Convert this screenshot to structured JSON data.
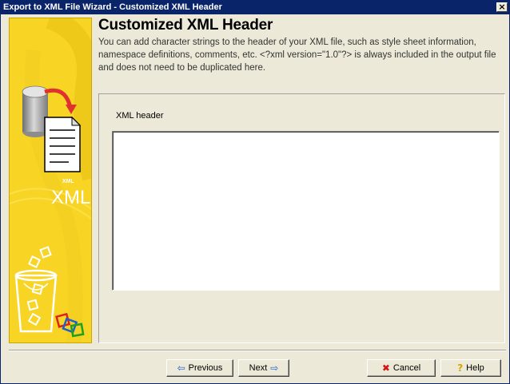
{
  "window": {
    "title": "Export to XML File Wizard - Customized XML Header",
    "close_glyph": "×"
  },
  "side_panel": {
    "image": "xml-export-illustration",
    "xml_small": "XML",
    "xml_large": "XML",
    "colors": {
      "background": "#f8d424",
      "arrow": "#e03030"
    }
  },
  "header": {
    "title": "Customized XML Header",
    "description": "You can add character strings to the header of your XML file, such as style sheet information, namespace definitions, comments, etc. <?xml version=\"1.0\"?> is always included in the output file and does not need to be duplicated here."
  },
  "form": {
    "label": "XML header",
    "value": ""
  },
  "buttons": {
    "previous": {
      "icon": "arrow-left-icon",
      "glyph": "⇦",
      "label": "Previous"
    },
    "next": {
      "icon": "arrow-right-icon",
      "glyph": "⇨",
      "label": "Next"
    },
    "cancel": {
      "icon": "x-icon",
      "glyph": "✖",
      "label": "Cancel"
    },
    "help": {
      "icon": "question-icon",
      "glyph": "?",
      "label": "Help"
    }
  }
}
